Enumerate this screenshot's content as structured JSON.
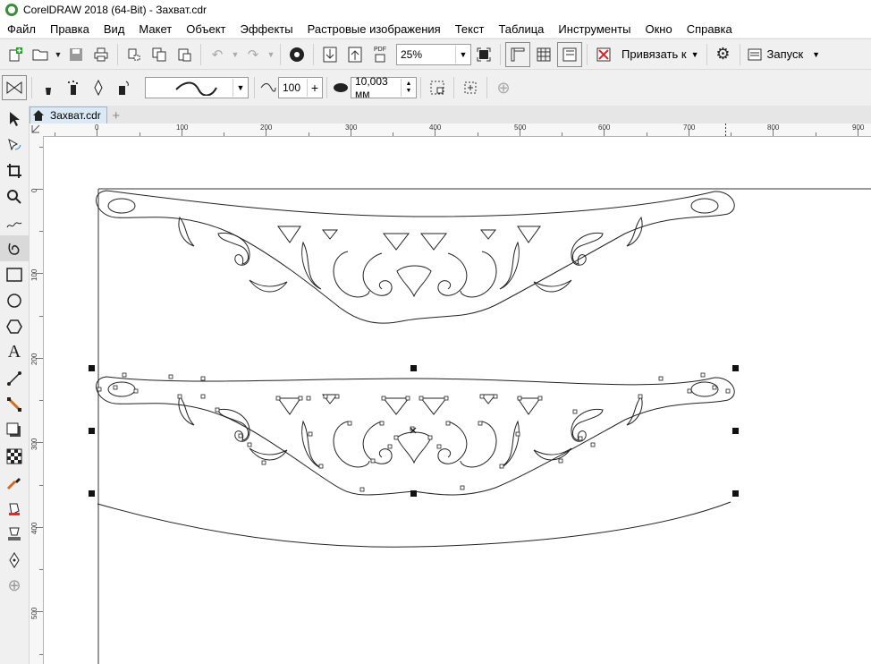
{
  "window": {
    "title": "CorelDRAW 2018 (64-Bit) - Захват.cdr"
  },
  "menu": [
    "Файл",
    "Правка",
    "Вид",
    "Макет",
    "Объект",
    "Эффекты",
    "Растровые изображения",
    "Текст",
    "Таблица",
    "Инструменты",
    "Окно",
    "Справка"
  ],
  "toolbar1": {
    "zoom": "25%",
    "snap_label": "Привязать к",
    "launch_label": "Запуск",
    "pdf_label": "PDF"
  },
  "toolbar2": {
    "smoothing_value": "100",
    "outline_width": "10,003 мм"
  },
  "document_tab": {
    "name": "Захват.cdr"
  },
  "rulers": {
    "horizontal": [
      "0",
      "100",
      "200",
      "300",
      "400",
      "500",
      "600",
      "700",
      "800",
      "900"
    ],
    "vertical": [
      "0",
      "100",
      "200",
      "300",
      "400",
      "500"
    ]
  },
  "icons": {
    "new": "new-document-icon",
    "open": "open-folder-icon",
    "save": "save-icon",
    "print": "print-icon",
    "zoom": "zoom-tool-icon"
  }
}
